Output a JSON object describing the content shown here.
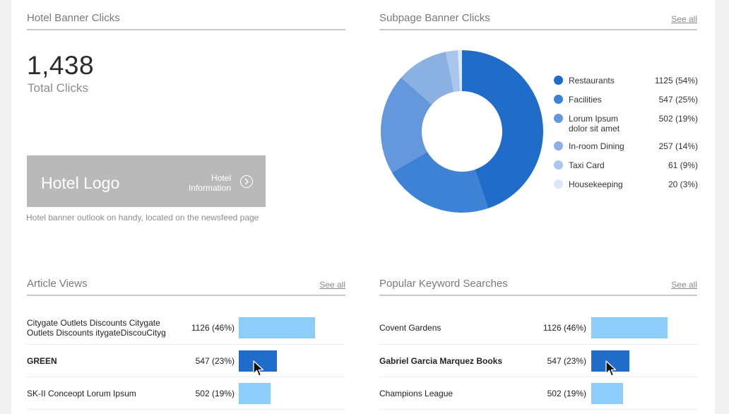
{
  "hotel_banner": {
    "title": "Hotel Banner Clicks",
    "total_value": "1,438",
    "total_label": "Total Clicks",
    "banner_logo_text": "Hotel Logo",
    "banner_info_line1": "Hotel",
    "banner_info_line2": "Information",
    "banner_arrow_icon": "chevron-right-circle-icon",
    "caption": "Hotel banner outlook on handy, located on the newsfeed page"
  },
  "subpage_banner": {
    "title": "Subpage Banner Clicks",
    "see_all": "See all",
    "legend": [
      {
        "label": "Restaurants",
        "value": "1125 (54%)",
        "color": "#1f6cc9"
      },
      {
        "label": "Facilities",
        "value": "547 (25%)",
        "color": "#3e82d6"
      },
      {
        "label": "Lorum Ipsum dolor sit amet",
        "value": "502 (19%)",
        "color": "#6497dc"
      },
      {
        "label": "In-room Dining",
        "value": "257 (14%)",
        "color": "#8bb0e2"
      },
      {
        "label": "Taxi Card",
        "value": "61 (9%)",
        "color": "#a9c6ec"
      },
      {
        "label": "Housekeeping",
        "value": "20 (3%)",
        "color": "#dde8f7"
      }
    ],
    "chart_data": {
      "type": "pie",
      "categories": [
        "Restaurants",
        "Facilities",
        "Lorum Ipsum dolor sit amet",
        "In-room Dining",
        "Taxi Card",
        "Housekeeping"
      ],
      "values": [
        1125,
        547,
        502,
        257,
        61,
        20
      ],
      "percent_labels": [
        "54%",
        "25%",
        "19%",
        "14%",
        "9%",
        "3%"
      ],
      "donut": true
    }
  },
  "article_views": {
    "title": "Article Views",
    "see_all": "See all",
    "rows": [
      {
        "name": "Citygate Outlets Discounts Citygate Outlets Discounts itygateDiscouCityg",
        "value": "1126 (46%)",
        "percent": 46,
        "bold": false,
        "highlight": false
      },
      {
        "name": "GREEN",
        "value": "547 (23%)",
        "percent": 23,
        "bold": true,
        "highlight": true
      },
      {
        "name": "SK-II Conceopt Lorum Ipsum",
        "value": "502 (19%)",
        "percent": 19,
        "bold": false,
        "highlight": false
      }
    ]
  },
  "keyword_searches": {
    "title": "Popular Keyword Searches",
    "see_all": "See all",
    "rows": [
      {
        "name": "Covent Gardens",
        "value": "1126 (46%)",
        "percent": 46,
        "bold": false,
        "highlight": false
      },
      {
        "name": "Gabriel Garcia Marquez Books",
        "value": "547 (23%)",
        "percent": 23,
        "bold": true,
        "highlight": true
      },
      {
        "name": "Champions League",
        "value": "502 (19%)",
        "percent": 19,
        "bold": false,
        "highlight": false
      }
    ]
  },
  "colors": {
    "bar_default": "#8dcdfc",
    "bar_highlight": "#1f6cc9",
    "divider": "#c9c9c9"
  },
  "cursor_icon": "mouse-pointer-icon"
}
